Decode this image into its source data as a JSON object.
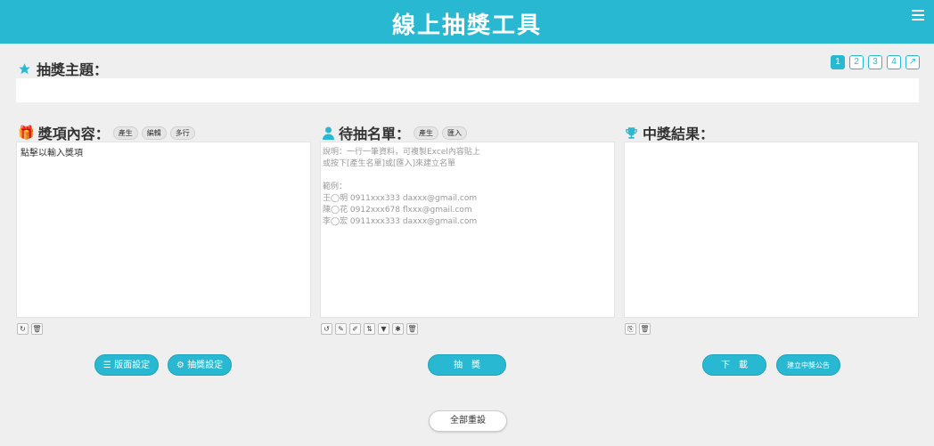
{
  "header": {
    "title": "線上抽獎工具",
    "menu_icon": "hamburger-icon"
  },
  "theme": {
    "label": "抽獎主題：",
    "icon": "star-icon",
    "value": ""
  },
  "pager": {
    "pages": [
      "1",
      "2",
      "3",
      "4"
    ],
    "active": "1",
    "expand_icon": "↗"
  },
  "prizes": {
    "label": "獎項內容：",
    "icon": "gift-icon",
    "chips": [
      "產生",
      "編輯",
      "多行"
    ],
    "content": "點擊以輸入獎項",
    "tools": [
      "↻",
      "🗑"
    ]
  },
  "candidates": {
    "label": "待抽名單：",
    "icon": "user-icon",
    "chips": [
      "產生",
      "匯入"
    ],
    "placeholder": "說明：一行一筆資料，可複製Excel內容貼上\n或按下[產生名單]或[匯入]來建立名單\n\n範例：\n王◯明 0911xxx333 daxxx@gmail.com\n陳◯花 0912xxx678 flxxx@gmail.com\n李◯宏 0911xxx333 daxxx@gmail.com",
    "tools": [
      "↺",
      "✎",
      "✐",
      "⇅",
      "▼",
      "✱",
      "🗑"
    ]
  },
  "results": {
    "label": "中獎結果：",
    "icon": "trophy-icon",
    "content": "",
    "tools": [
      "⎘",
      "🗑"
    ]
  },
  "buttons": {
    "layout": "☰ 版面設定",
    "settings": "⚙ 抽獎設定",
    "draw": "抽　獎",
    "download": "下　載",
    "announce": "建立中獎公告",
    "reset": "全部重設"
  },
  "colors": {
    "accent": "#29b8d2",
    "background": "#efefef"
  }
}
